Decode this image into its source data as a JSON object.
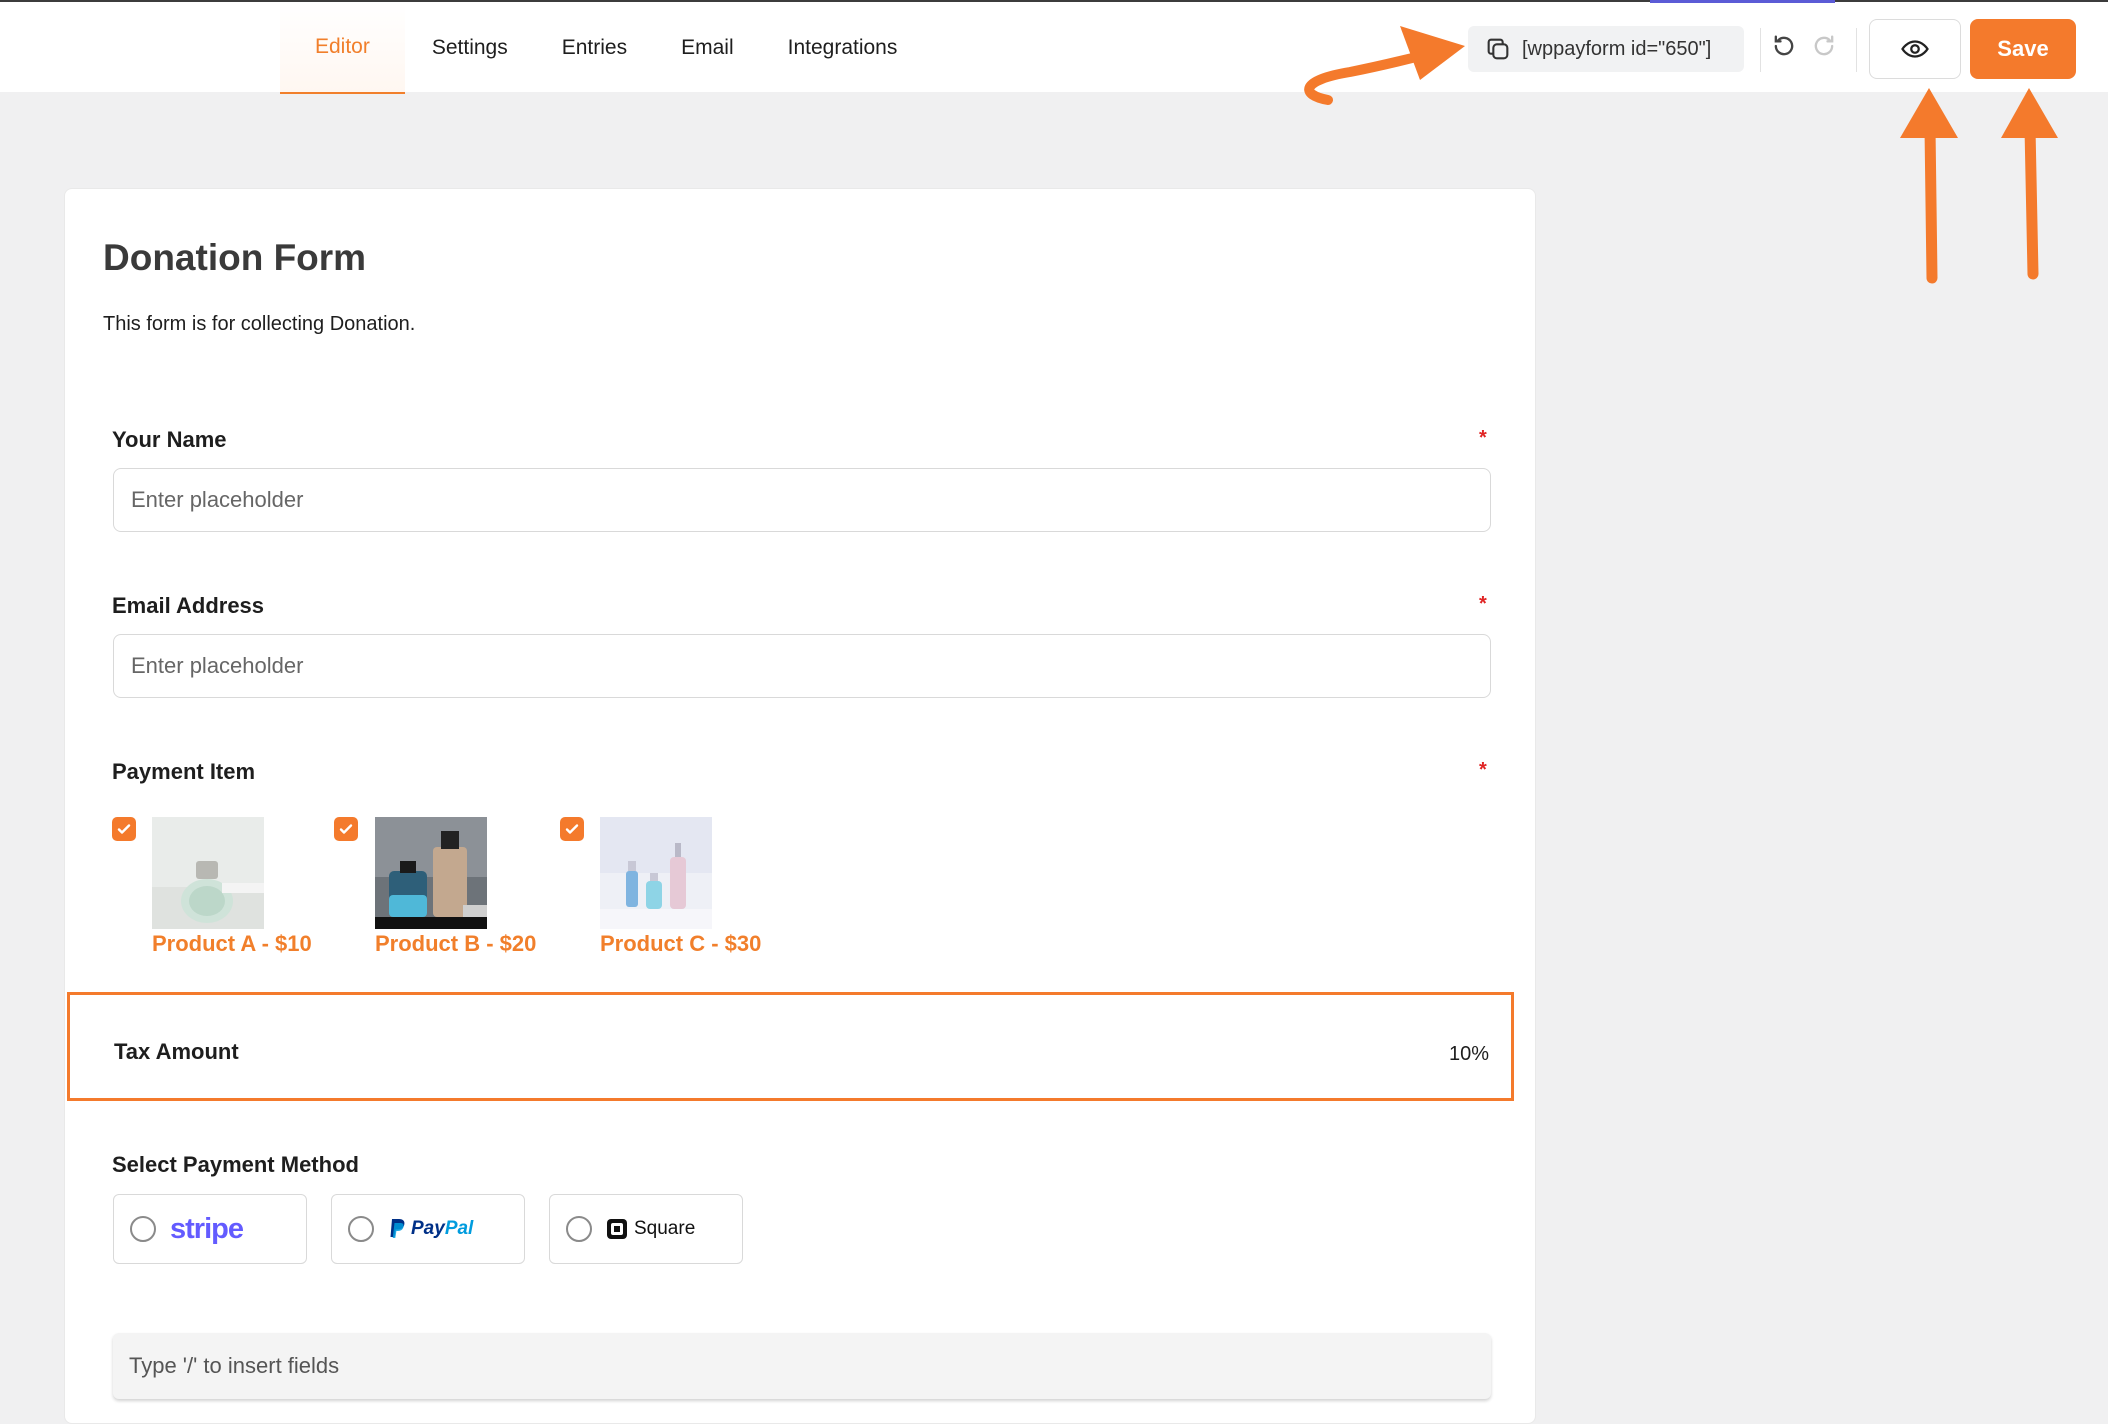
{
  "tabs": [
    {
      "label": "Editor",
      "active": true
    },
    {
      "label": "Settings",
      "active": false
    },
    {
      "label": "Entries",
      "active": false
    },
    {
      "label": "Email",
      "active": false
    },
    {
      "label": "Integrations",
      "active": false
    }
  ],
  "toolbar": {
    "shortcode": "[wppayform id=\"650\"]",
    "copy_icon": "copy-icon",
    "undo_icon": "undo-icon",
    "redo_icon": "redo-icon",
    "preview_icon": "eye-icon",
    "save_label": "Save"
  },
  "form": {
    "title": "Donation Form",
    "description": "This form is for collecting Donation.",
    "fields": {
      "name": {
        "label": "Your Name",
        "required_mark": "*",
        "placeholder": "Enter placeholder"
      },
      "email": {
        "label": "Email Address",
        "required_mark": "*",
        "placeholder": "Enter placeholder"
      },
      "payment_item": {
        "label": "Payment Item",
        "required_mark": "*",
        "items": [
          {
            "label": "Product A - $10",
            "checked": true
          },
          {
            "label": "Product B - $20",
            "checked": true
          },
          {
            "label": "Product C - $30",
            "checked": true
          }
        ]
      },
      "tax": {
        "label": "Tax Amount",
        "value": "10%"
      },
      "payment_method": {
        "label": "Select Payment Method",
        "options": [
          {
            "name": "stripe",
            "text": "stripe"
          },
          {
            "name": "paypal",
            "text_a": "Pay",
            "text_b": "Pal"
          },
          {
            "name": "square",
            "text": "Square"
          }
        ]
      }
    },
    "insert_hint": "Type '/' to insert fields"
  },
  "colors": {
    "accent": "#f47a2c",
    "tab_active": "#f17f2b",
    "required": "#e02424",
    "stripe": "#635bff",
    "paypal_dark": "#003087",
    "paypal_light": "#009cde"
  }
}
